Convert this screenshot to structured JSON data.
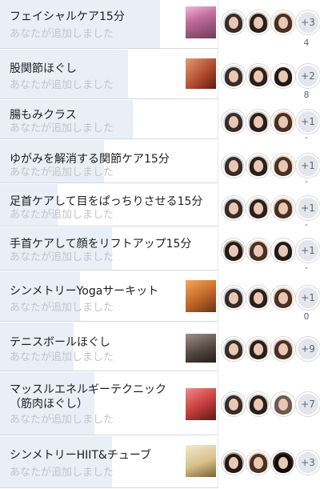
{
  "rows": [
    {
      "title": "フェイシャルケア15分",
      "subtitle": "あなたが追加しました",
      "more": "+3",
      "frag": "4"
    },
    {
      "title": "股関節ほぐし",
      "subtitle": "あなたが追加しました",
      "more": "+2",
      "frag": "8"
    },
    {
      "title": "腸もみクラス",
      "subtitle": "あなたが追加しました",
      "more": "+1",
      "frag": "-"
    },
    {
      "title": "ゆがみを解消する関節ケア15分",
      "subtitle": "あなたが追加しました",
      "more": "+1",
      "frag": "-"
    },
    {
      "title": "足首ケアして目をぱっちりさせる15分",
      "subtitle": "あなたが追加しました",
      "more": "+1",
      "frag": "-"
    },
    {
      "title": "手首ケアして顔をリフトアップ15分",
      "subtitle": "あなたが追加しました",
      "more": "+1",
      "frag": "-"
    },
    {
      "title": "シンメトリーYogaサーキット",
      "subtitle": "あなたが追加しました",
      "more": "+1",
      "frag": "0"
    },
    {
      "title": "テニスボールほぐし",
      "subtitle": "あなたが追加しました",
      "more": "+9",
      "frag": ""
    },
    {
      "title": "マッスルエネルギーテクニック（筋肉ほぐし）",
      "subtitle": "あなたが追加しました",
      "more": "+7",
      "frag": ""
    },
    {
      "title": "シンメトリーHIIT&チューブ",
      "subtitle": "あなたが追加しました",
      "more": "+3",
      "frag": ""
    }
  ],
  "colors": {
    "card_shade": "#e9eef7",
    "subtitle": "#c2c5cb",
    "more_badge": "#e4e6eb"
  }
}
